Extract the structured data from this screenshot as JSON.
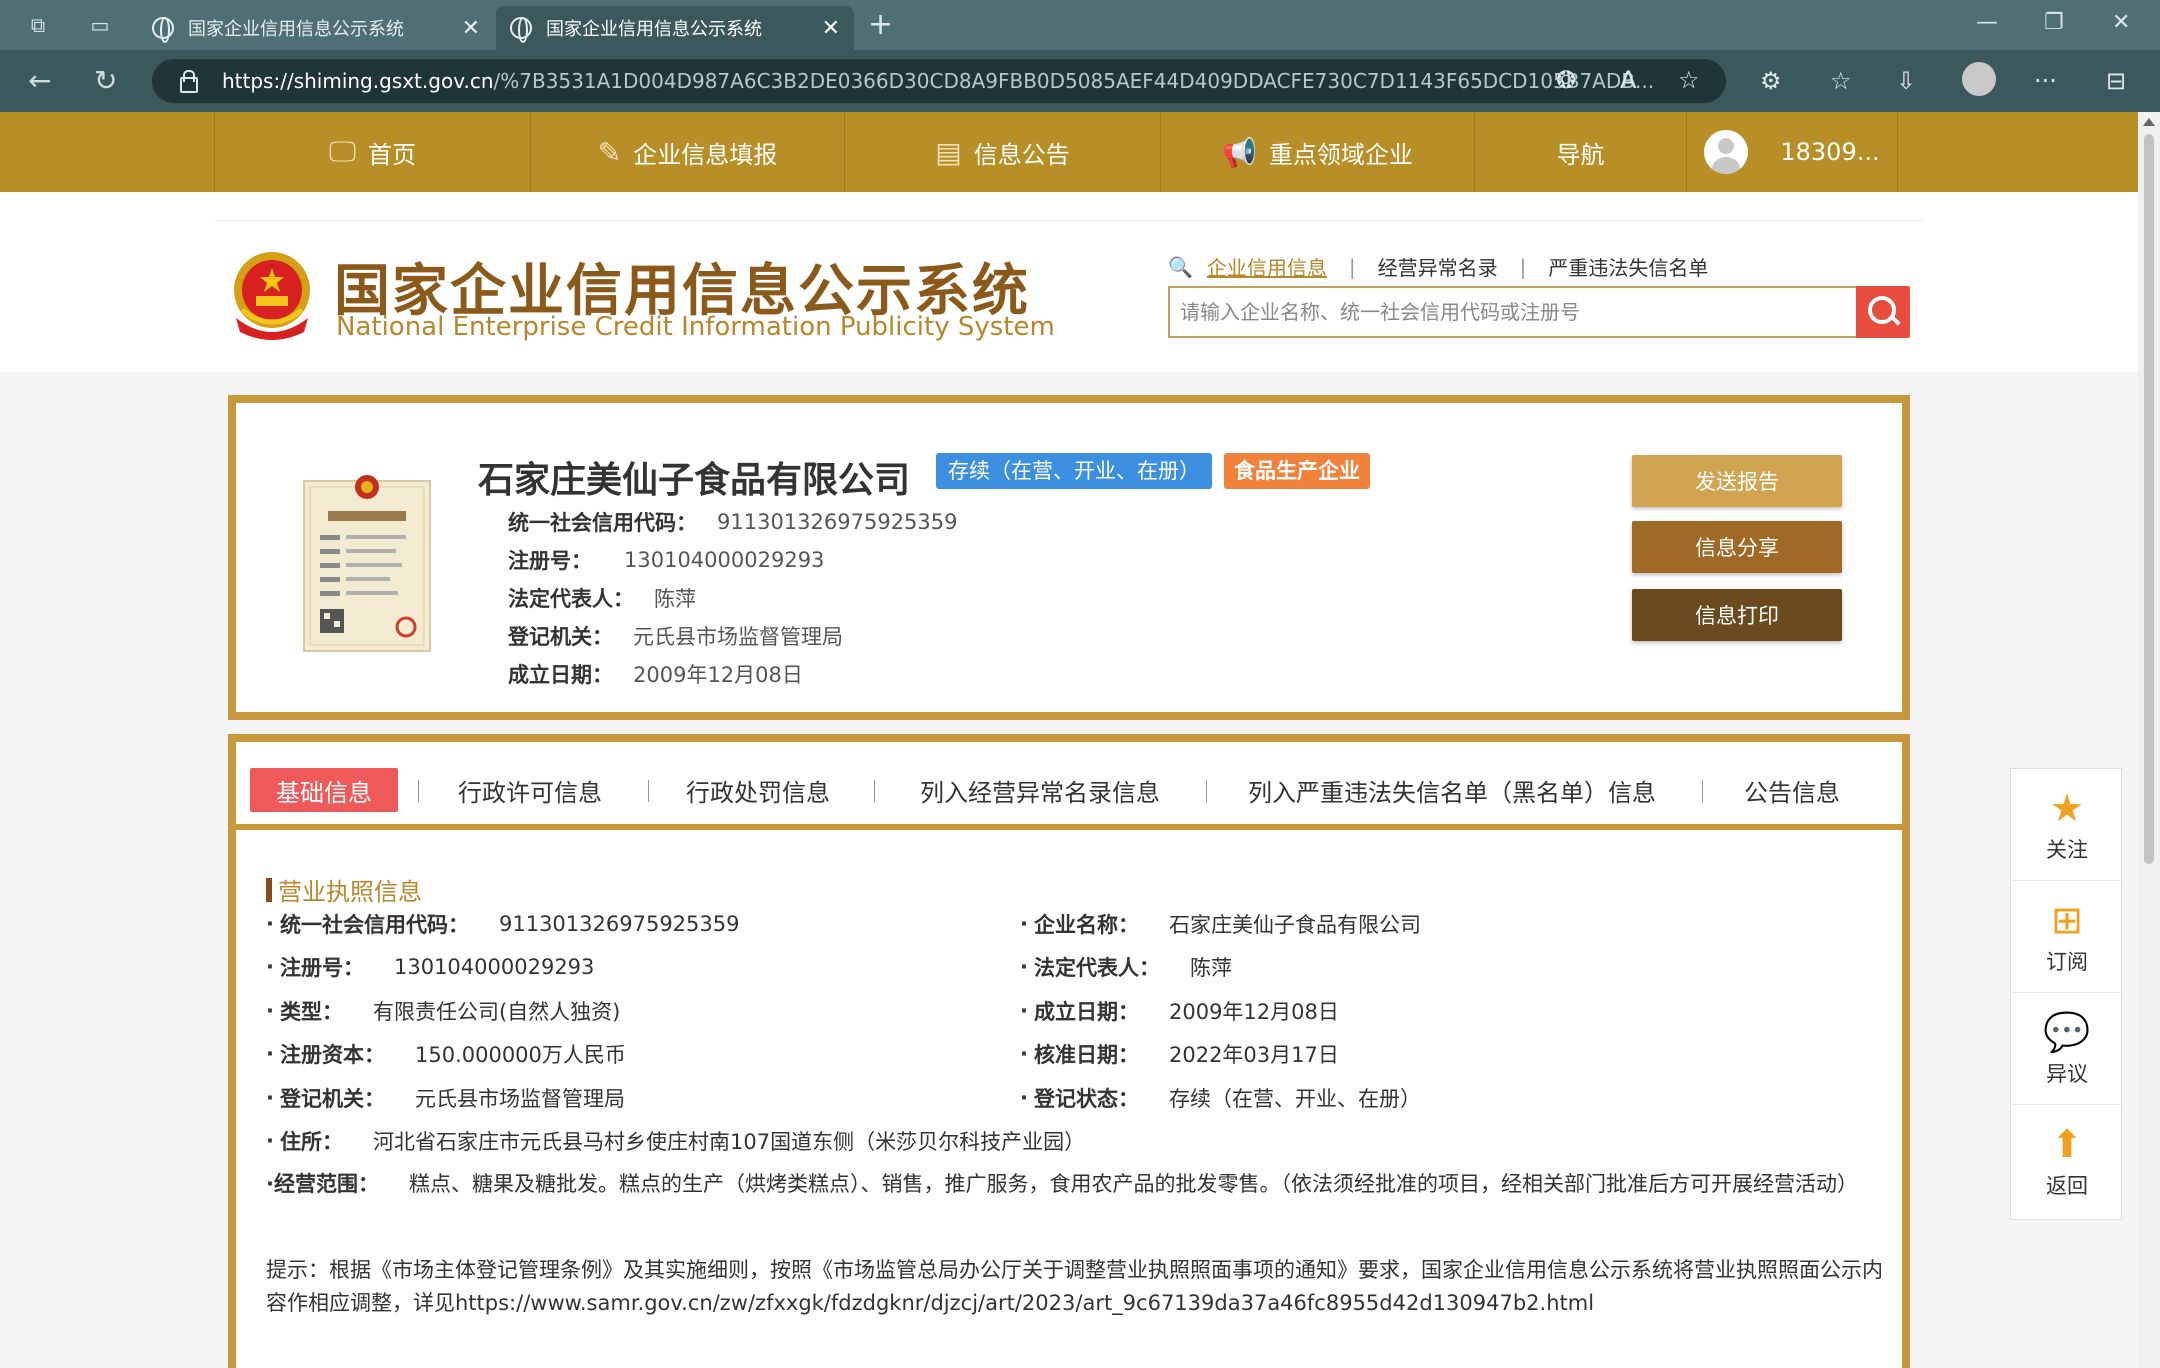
{
  "browser": {
    "tabs": [
      {
        "title": "国家企业信用信息公示系统",
        "active": false
      },
      {
        "title": "国家企业信用信息公示系统",
        "active": true
      }
    ],
    "new_tab_icon": "plus-icon",
    "url_host": "https://shiming.gsxt.gov.cn",
    "url_path": "/%7B3531A1D004D987A6C3B2DE0366D30CD8A9FBB0D5085AEF44D409DDACFE730C7D1143F65DCD105B7ADB..."
  },
  "site_nav": {
    "items": [
      {
        "label": "首页",
        "icon": "monitor-icon"
      },
      {
        "label": "企业信息填报",
        "icon": "edit-icon"
      },
      {
        "label": "信息公告",
        "icon": "document-icon"
      },
      {
        "label": "重点领域企业",
        "icon": "megaphone-icon"
      },
      {
        "label": "导航",
        "icon": ""
      }
    ],
    "user": "18309..."
  },
  "header": {
    "logo_cn": "国家企业信用信息公示系统",
    "logo_en": "National Enterprise Credit Information Publicity System",
    "search_links": [
      "企业信用信息",
      "经营异常名录",
      "严重违法失信名单"
    ],
    "search_placeholder": "请输入企业名称、统一社会信用代码或注册号"
  },
  "company": {
    "name": "石家庄美仙子食品有限公司",
    "status_badge": "存续（在营、开业、在册）",
    "type_badge": "食品生产企业",
    "fields": [
      {
        "key": "统一社会信用代码：",
        "value": "911301326975925359"
      },
      {
        "key": "注册号：",
        "value": "130104000029293"
      },
      {
        "key": "法定代表人：",
        "value": "陈萍"
      },
      {
        "key": "登记机关：",
        "value": "元氏县市场监督管理局"
      },
      {
        "key": "成立日期：",
        "value": "2009年12月08日"
      }
    ],
    "buttons": [
      "发送报告",
      "信息分享",
      "信息打印"
    ]
  },
  "tabs": [
    "基础信息",
    "行政许可信息",
    "行政处罚信息",
    "列入经营异常名录信息",
    "列入严重违法失信名单（黑名单）信息",
    "公告信息"
  ],
  "license": {
    "section_title": "营业执照信息",
    "left": [
      {
        "key": "统一社会信用代码：",
        "value": "911301326975925359"
      },
      {
        "key": "注册号：",
        "value": "130104000029293"
      },
      {
        "key": "类型：",
        "value": "有限责任公司(自然人独资)"
      },
      {
        "key": "注册资本：",
        "value": "150.000000万人民币"
      },
      {
        "key": "登记机关：",
        "value": "元氏县市场监督管理局"
      }
    ],
    "right": [
      {
        "key": "企业名称：",
        "value": "石家庄美仙子食品有限公司"
      },
      {
        "key": "法定代表人：",
        "value": "陈萍"
      },
      {
        "key": "成立日期：",
        "value": "2009年12月08日"
      },
      {
        "key": "核准日期：",
        "value": "2022年03月17日"
      },
      {
        "key": "登记状态：",
        "value": "存续（在营、开业、在册）"
      }
    ],
    "address_key": "住所：",
    "address_value": "河北省石家庄市元氏县马村乡使庄村南107国道东侧（米莎贝尔科技产业园）",
    "scope_key": "经营范围：",
    "scope_value": "糕点、糖果及糖批发。糕点的生产（烘烤类糕点）、销售，推广服务，食用农产品的批发零售。（依法须经批准的项目，经相关部门批准后方可开展经营活动）",
    "notice": "提示：根据《市场主体登记管理条例》及其实施细则，按照《市场监管总局办公厅关于调整营业执照照面事项的通知》要求，国家企业信用信息公示系统将营业执照照面公示内容作相应调整，详见https://www.samr.gov.cn/zw/zfxxgk/fdzdgknr/djzcj/art/2023/art_9c67139da37a46fc8955d42d130947b2.html"
  },
  "float_bar": [
    {
      "label": "关注",
      "icon": "star-icon"
    },
    {
      "label": "订阅",
      "icon": "plus-square-icon"
    },
    {
      "label": "异议",
      "icon": "chat-bubble-icon"
    },
    {
      "label": "返回",
      "icon": "arrow-up-icon"
    }
  ],
  "colors": {
    "nav_gold": "#b88f27",
    "card_border": "#c8993a",
    "status_blue": "#3d8fe0",
    "type_orange": "#f0823c",
    "tab_active_red": "#ee5a5a",
    "btn_send": "#d0a450",
    "btn_share": "#a06a26",
    "btn_print": "#6b4a1e"
  }
}
